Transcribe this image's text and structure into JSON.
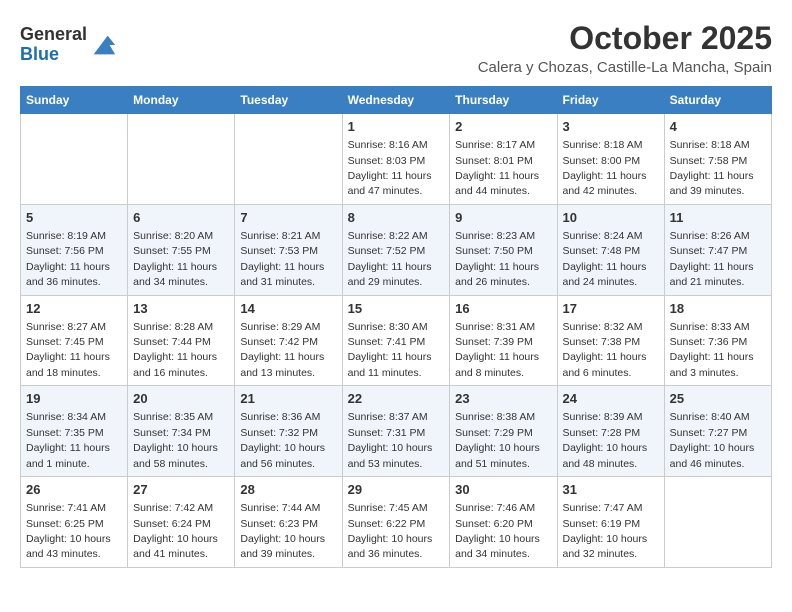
{
  "header": {
    "logo_line1": "General",
    "logo_line2": "Blue",
    "month": "October 2025",
    "location": "Calera y Chozas, Castille-La Mancha, Spain"
  },
  "columns": [
    "Sunday",
    "Monday",
    "Tuesday",
    "Wednesday",
    "Thursday",
    "Friday",
    "Saturday"
  ],
  "weeks": [
    [
      {
        "day": "",
        "info": ""
      },
      {
        "day": "",
        "info": ""
      },
      {
        "day": "",
        "info": ""
      },
      {
        "day": "1",
        "info": "Sunrise: 8:16 AM\nSunset: 8:03 PM\nDaylight: 11 hours and 47 minutes."
      },
      {
        "day": "2",
        "info": "Sunrise: 8:17 AM\nSunset: 8:01 PM\nDaylight: 11 hours and 44 minutes."
      },
      {
        "day": "3",
        "info": "Sunrise: 8:18 AM\nSunset: 8:00 PM\nDaylight: 11 hours and 42 minutes."
      },
      {
        "day": "4",
        "info": "Sunrise: 8:18 AM\nSunset: 7:58 PM\nDaylight: 11 hours and 39 minutes."
      }
    ],
    [
      {
        "day": "5",
        "info": "Sunrise: 8:19 AM\nSunset: 7:56 PM\nDaylight: 11 hours and 36 minutes."
      },
      {
        "day": "6",
        "info": "Sunrise: 8:20 AM\nSunset: 7:55 PM\nDaylight: 11 hours and 34 minutes."
      },
      {
        "day": "7",
        "info": "Sunrise: 8:21 AM\nSunset: 7:53 PM\nDaylight: 11 hours and 31 minutes."
      },
      {
        "day": "8",
        "info": "Sunrise: 8:22 AM\nSunset: 7:52 PM\nDaylight: 11 hours and 29 minutes."
      },
      {
        "day": "9",
        "info": "Sunrise: 8:23 AM\nSunset: 7:50 PM\nDaylight: 11 hours and 26 minutes."
      },
      {
        "day": "10",
        "info": "Sunrise: 8:24 AM\nSunset: 7:48 PM\nDaylight: 11 hours and 24 minutes."
      },
      {
        "day": "11",
        "info": "Sunrise: 8:26 AM\nSunset: 7:47 PM\nDaylight: 11 hours and 21 minutes."
      }
    ],
    [
      {
        "day": "12",
        "info": "Sunrise: 8:27 AM\nSunset: 7:45 PM\nDaylight: 11 hours and 18 minutes."
      },
      {
        "day": "13",
        "info": "Sunrise: 8:28 AM\nSunset: 7:44 PM\nDaylight: 11 hours and 16 minutes."
      },
      {
        "day": "14",
        "info": "Sunrise: 8:29 AM\nSunset: 7:42 PM\nDaylight: 11 hours and 13 minutes."
      },
      {
        "day": "15",
        "info": "Sunrise: 8:30 AM\nSunset: 7:41 PM\nDaylight: 11 hours and 11 minutes."
      },
      {
        "day": "16",
        "info": "Sunrise: 8:31 AM\nSunset: 7:39 PM\nDaylight: 11 hours and 8 minutes."
      },
      {
        "day": "17",
        "info": "Sunrise: 8:32 AM\nSunset: 7:38 PM\nDaylight: 11 hours and 6 minutes."
      },
      {
        "day": "18",
        "info": "Sunrise: 8:33 AM\nSunset: 7:36 PM\nDaylight: 11 hours and 3 minutes."
      }
    ],
    [
      {
        "day": "19",
        "info": "Sunrise: 8:34 AM\nSunset: 7:35 PM\nDaylight: 11 hours and 1 minute."
      },
      {
        "day": "20",
        "info": "Sunrise: 8:35 AM\nSunset: 7:34 PM\nDaylight: 10 hours and 58 minutes."
      },
      {
        "day": "21",
        "info": "Sunrise: 8:36 AM\nSunset: 7:32 PM\nDaylight: 10 hours and 56 minutes."
      },
      {
        "day": "22",
        "info": "Sunrise: 8:37 AM\nSunset: 7:31 PM\nDaylight: 10 hours and 53 minutes."
      },
      {
        "day": "23",
        "info": "Sunrise: 8:38 AM\nSunset: 7:29 PM\nDaylight: 10 hours and 51 minutes."
      },
      {
        "day": "24",
        "info": "Sunrise: 8:39 AM\nSunset: 7:28 PM\nDaylight: 10 hours and 48 minutes."
      },
      {
        "day": "25",
        "info": "Sunrise: 8:40 AM\nSunset: 7:27 PM\nDaylight: 10 hours and 46 minutes."
      }
    ],
    [
      {
        "day": "26",
        "info": "Sunrise: 7:41 AM\nSunset: 6:25 PM\nDaylight: 10 hours and 43 minutes."
      },
      {
        "day": "27",
        "info": "Sunrise: 7:42 AM\nSunset: 6:24 PM\nDaylight: 10 hours and 41 minutes."
      },
      {
        "day": "28",
        "info": "Sunrise: 7:44 AM\nSunset: 6:23 PM\nDaylight: 10 hours and 39 minutes."
      },
      {
        "day": "29",
        "info": "Sunrise: 7:45 AM\nSunset: 6:22 PM\nDaylight: 10 hours and 36 minutes."
      },
      {
        "day": "30",
        "info": "Sunrise: 7:46 AM\nSunset: 6:20 PM\nDaylight: 10 hours and 34 minutes."
      },
      {
        "day": "31",
        "info": "Sunrise: 7:47 AM\nSunset: 6:19 PM\nDaylight: 10 hours and 32 minutes."
      },
      {
        "day": "",
        "info": ""
      }
    ]
  ]
}
